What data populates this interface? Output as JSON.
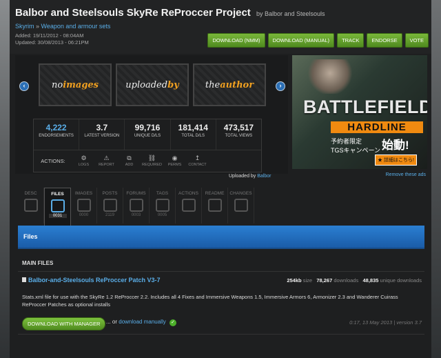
{
  "header": {
    "title": "Balbor and Steelsouls SkyRe ReProccer Project",
    "by_author": "by Balbor and Steelsouls",
    "breadcrumb": {
      "game": "Skyrim",
      "separator": "»",
      "category": "Weapon and armour sets"
    },
    "added": "Added: 19/11/2012 - 08:04AM",
    "updated": "Updated: 30/08/2013 - 06:21PM",
    "buttons": [
      "DOWNLOAD (NMM)",
      "DOWNLOAD (MANUAL)",
      "TRACK",
      "ENDORSE",
      "VOTE"
    ]
  },
  "feature": {
    "thumbs": [
      {
        "plain": "no",
        "bold": "images"
      },
      {
        "plain": "uploaded",
        "bold": "by"
      },
      {
        "plain": "the",
        "bold": "author"
      }
    ],
    "stats": [
      {
        "value": "4,222",
        "label": "ENDORSEMENTS"
      },
      {
        "value": "3.7",
        "label": "LATEST VERSION"
      },
      {
        "value": "99,716",
        "label": "UNIQUE D/LS"
      },
      {
        "value": "181,414",
        "label": "TOTAL D/LS"
      },
      {
        "value": "473,517",
        "label": "TOTAL VIEWS"
      }
    ],
    "actions_label": "ACTIONS:",
    "actions": [
      {
        "label": "LOGS",
        "icon": "gear-icon"
      },
      {
        "label": "REPORT",
        "icon": "warning-icon"
      },
      {
        "label": "ADD",
        "icon": "add-icon"
      },
      {
        "label": "REQUIRED",
        "icon": "link-icon"
      },
      {
        "label": "PERMS",
        "icon": "permissions-icon"
      },
      {
        "label": "CONTACT",
        "icon": "contact-icon"
      }
    ],
    "uploaded_by_label": "Uploaded by",
    "uploaded_by": "Balbor"
  },
  "ad": {
    "title": "BATTLEFIELD",
    "subtitle": "HARDLINE",
    "jp_line1": "予約者限定",
    "jp_line2": "TGSキャンペーン",
    "jp_big": "始動!",
    "jp_button": "★ 詳細はこちら!",
    "remove": "Remove these ads"
  },
  "tabs": [
    {
      "label": "DESC",
      "count": ""
    },
    {
      "label": "FILES",
      "count": "0031"
    },
    {
      "label": "IMAGES",
      "count": "0000"
    },
    {
      "label": "POSTS",
      "count": "2119"
    },
    {
      "label": "FORUMS",
      "count": "0003"
    },
    {
      "label": "TAGS",
      "count": "0005"
    },
    {
      "label": "ACTIONS",
      "count": ""
    },
    {
      "label": "README",
      "count": ""
    },
    {
      "label": "CHANGES",
      "count": ""
    }
  ],
  "files": {
    "bar_title": "Files",
    "section": "MAIN FILES",
    "file": {
      "name": "Balbor-and-Steelsouls ReProccer Patch V3-7",
      "size_value": "254kb",
      "size_label": "size",
      "downloads_value": "78,267",
      "downloads_label": "downloads",
      "unique_value": "48,835",
      "unique_label": "unique downloads",
      "description": "Stats.xml file for use with the SkyRe 1.2 ReProccer 2.2. Includes all 4 Fixes and Immersive Weapons 1.5, Immersive Armors 6, Armonizer 2.3 and Wanderer Cuirass ReProccer Patches as optional installs",
      "download_button": "DOWNLOAD WITH MANAGER",
      "or_text": "... or",
      "manual_link": "download manually",
      "version_info": "0:17, 13 May 2013  |  version 3.7"
    }
  }
}
